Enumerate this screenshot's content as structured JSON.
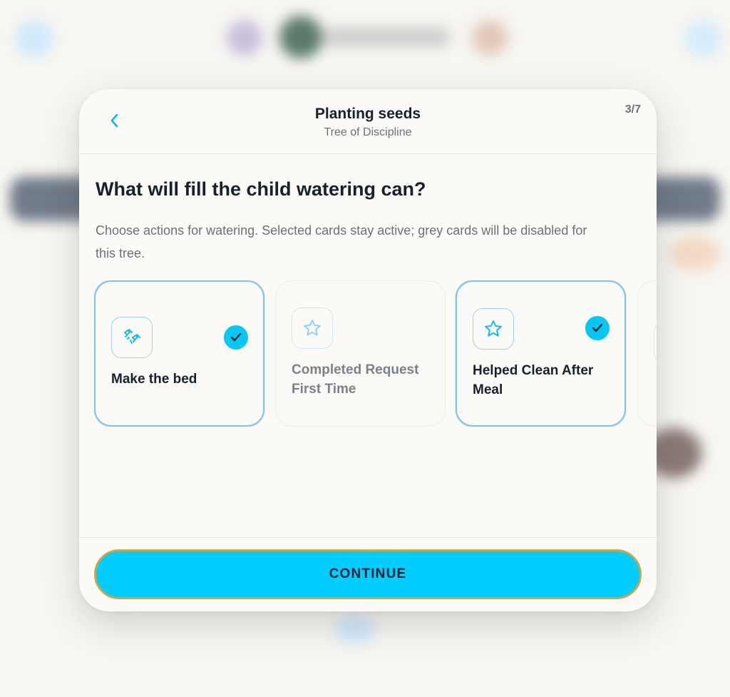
{
  "modal": {
    "title": "Planting seeds",
    "subtitle": "Tree of Discipline",
    "step": "3/7",
    "question": "What will fill the child watering can?",
    "description": "Choose actions for watering. Selected cards stay active; grey cards will be disabled for this tree."
  },
  "cards": [
    {
      "label": "Make the bed",
      "icon": "bed-icon",
      "selected": true
    },
    {
      "label": "Completed Request First Time",
      "icon": "star-icon",
      "selected": false
    },
    {
      "label": "Helped Clean After Meal",
      "icon": "star-icon",
      "selected": true
    },
    {
      "label": "",
      "icon": "star-icon",
      "selected": false
    }
  ],
  "footer": {
    "continue_label": "CONTINUE"
  },
  "colors": {
    "accent": "#02cdfd",
    "selected_border": "#7cc4ea",
    "button_border": "#c7a84a",
    "text_primary": "#16202e",
    "text_secondary": "#6b7079"
  }
}
